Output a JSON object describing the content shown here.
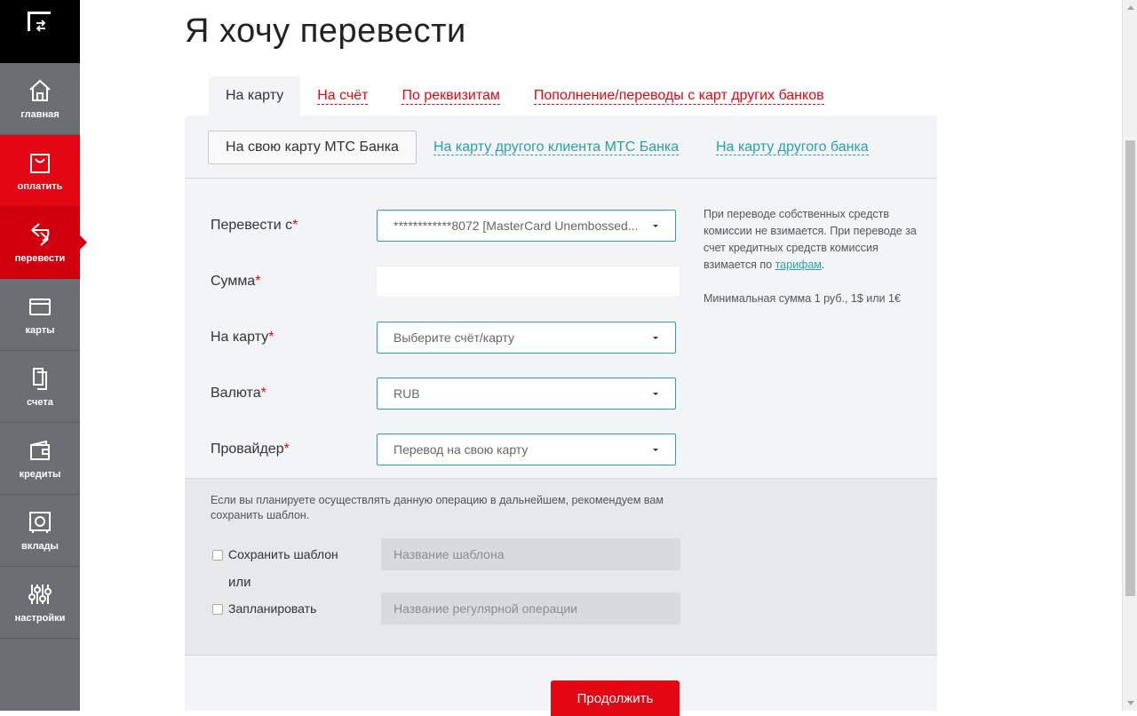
{
  "sidebar": {
    "items": [
      {
        "label": "главная",
        "icon": "home-icon"
      },
      {
        "label": "оплатить",
        "icon": "bag-icon"
      },
      {
        "label": "перевести",
        "icon": "transfer-icon"
      },
      {
        "label": "карты",
        "icon": "card-icon"
      },
      {
        "label": "счета",
        "icon": "documents-icon"
      },
      {
        "label": "кредиты",
        "icon": "wallet-icon"
      },
      {
        "label": "вклады",
        "icon": "safe-icon"
      },
      {
        "label": "настройки",
        "icon": "sliders-icon"
      }
    ],
    "active": "перевести"
  },
  "page": {
    "title": "Я хочу перевести"
  },
  "tabs": [
    "На карту",
    "На счёт",
    "По реквизитам",
    "Пополнение/переводы с карт других банков"
  ],
  "subtabs": [
    "На свою карту МТС Банка",
    "На карту другого клиента МТС Банка",
    "На карту другого банка"
  ],
  "form": {
    "from_label": "Перевести с",
    "from_value": "************8072 [MasterCard Unembossed...",
    "amount_label": "Сумма",
    "amount_value": "",
    "to_label": "На карту",
    "to_placeholder": "Выберите счёт/карту",
    "currency_label": "Валюта",
    "currency_value": "RUB",
    "provider_label": "Провайдер",
    "provider_value": "Перевод на свою карту",
    "required_mark": "*"
  },
  "info": {
    "text": "При переводе собственных средств комиссии не взимается. При переводе за счет кредитных средств комиссия взимается по",
    "link": "тарифам",
    "dot": ".",
    "min_amount": "Минимальная сумма 1 руб., 1$ или 1€"
  },
  "template": {
    "hint": "Если вы планируете осуществлять данную операцию в дальнейшем, рекомендуем вам сохранить шаблон.",
    "save_label": "Сохранить шаблон",
    "save_placeholder": "Название шаблона",
    "or_label": "или",
    "schedule_label": "Запланировать",
    "schedule_placeholder": "Название регулярной операции"
  },
  "actions": {
    "continue_label": "Продолжить"
  },
  "colors": {
    "brand_red": "#e30613",
    "active_red": "#d1000f",
    "link_teal": "#2a9fae",
    "sidebar_gray": "#6b6e72"
  }
}
